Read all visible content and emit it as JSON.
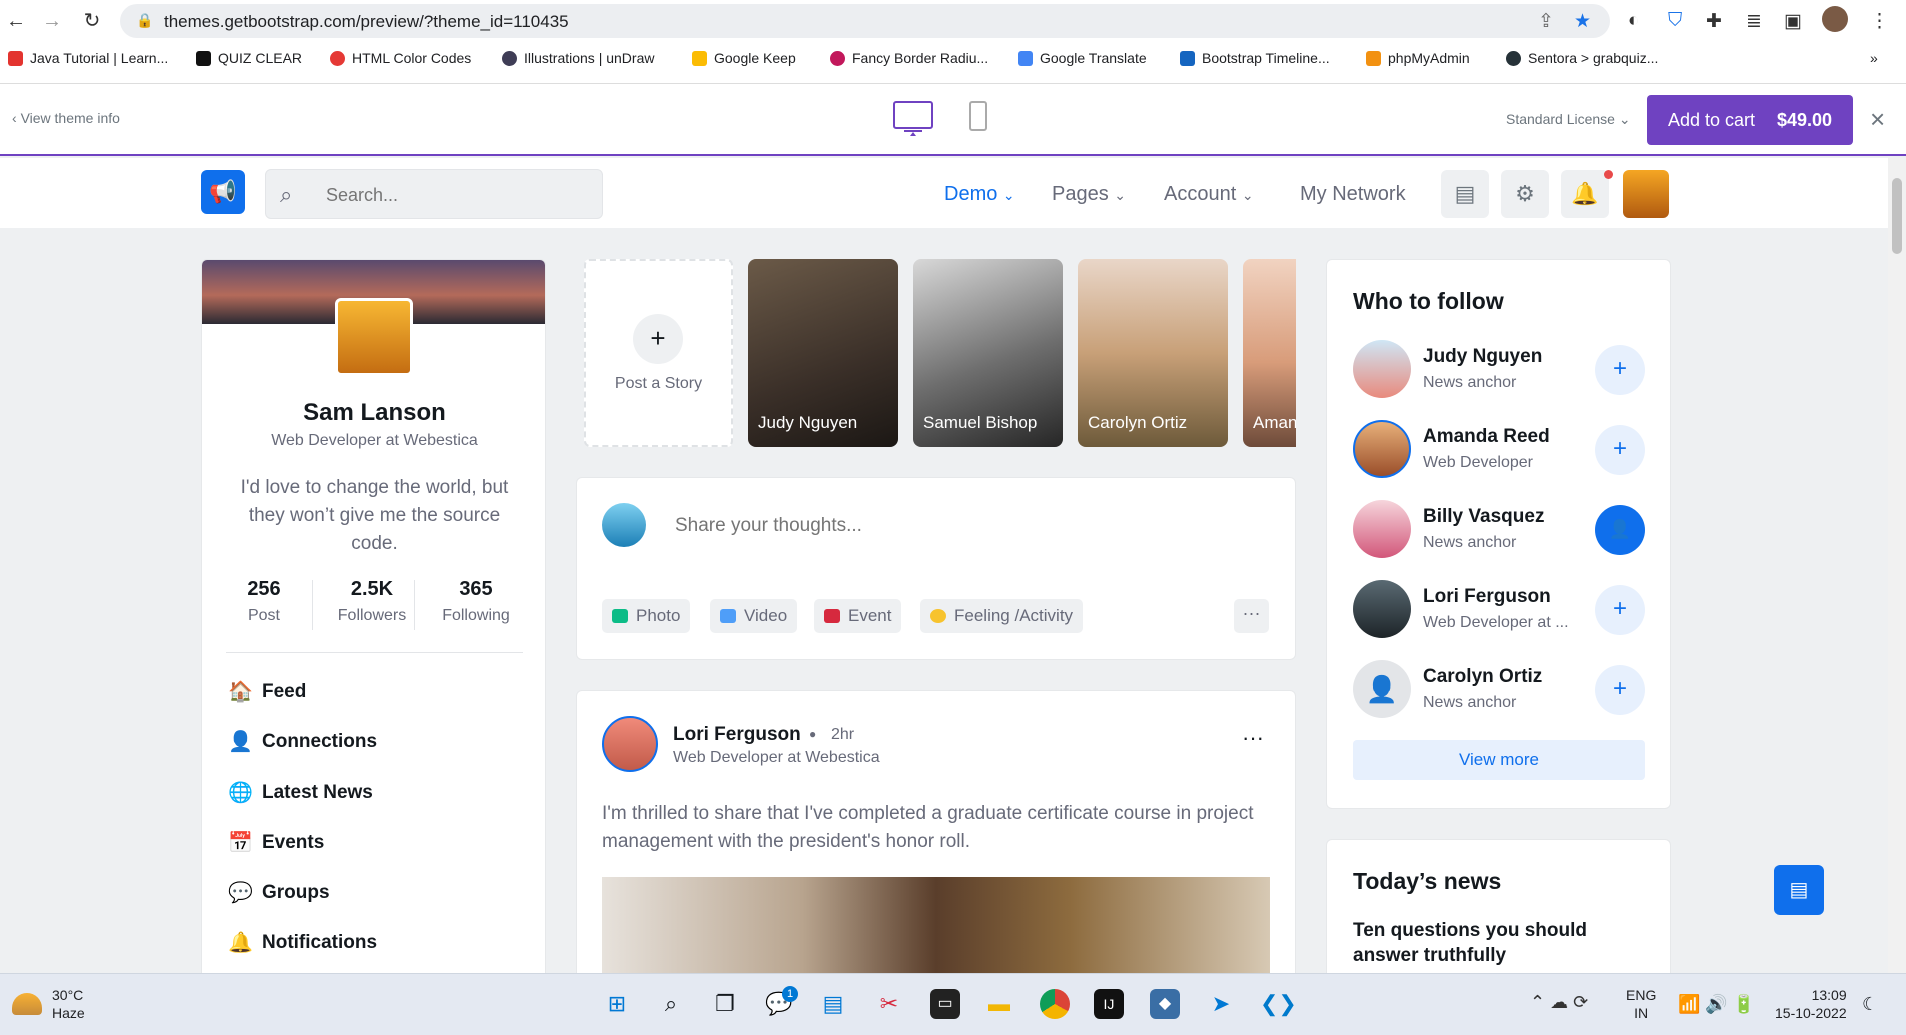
{
  "browser": {
    "url": "themes.getbootstrap.com/preview/?theme_id=110435",
    "bookmarks": [
      "Java Tutorial | Learn...",
      "QUIZ CLEAR",
      "HTML Color Codes",
      "Illustrations | unDraw",
      "Google Keep",
      "Fancy Border Radiu...",
      "Google Translate",
      "Bootstrap Timeline...",
      "phpMyAdmin",
      "Sentora > grabquiz..."
    ],
    "more": "»"
  },
  "preview_bar": {
    "back_label": "View theme info",
    "license": "Standard License",
    "cart_label": "Add to cart",
    "price": "$49.00",
    "close": "×"
  },
  "header": {
    "search_placeholder": "Search...",
    "nav": [
      "Demo",
      "Pages",
      "Account",
      "My Network"
    ]
  },
  "profile": {
    "name": "Sam Lanson",
    "role": "Web Developer at Webestica",
    "bio": "I'd love to change the world, but they won’t give me the source code.",
    "stats": [
      {
        "value": "256",
        "label": "Post"
      },
      {
        "value": "2.5K",
        "label": "Followers"
      },
      {
        "value": "365",
        "label": "Following"
      }
    ],
    "menu": [
      "Feed",
      "Connections",
      "Latest News",
      "Events",
      "Groups",
      "Notifications"
    ]
  },
  "stories": {
    "post_label": "Post a Story",
    "items": [
      "Judy Nguyen",
      "Samuel Bishop",
      "Carolyn Ortiz",
      "Aman"
    ]
  },
  "composer": {
    "placeholder": "Share your thoughts...",
    "actions": [
      "Photo",
      "Video",
      "Event",
      "Feeling /Activity"
    ],
    "more": "···"
  },
  "post": {
    "author": "Lori Ferguson",
    "time": "2hr",
    "role": "Web Developer at Webestica",
    "text": "I'm thrilled to share that I've completed a graduate certificate course in project management with the president's honor roll.",
    "more": "···"
  },
  "follow": {
    "title": "Who to follow",
    "items": [
      {
        "name": "Judy Nguyen",
        "role": "News anchor"
      },
      {
        "name": "Amanda Reed",
        "role": "Web Developer"
      },
      {
        "name": "Billy Vasquez",
        "role": "News anchor"
      },
      {
        "name": "Lori Ferguson",
        "role": "Web Developer at ..."
      },
      {
        "name": "Carolyn Ortiz",
        "role": "News anchor"
      }
    ],
    "view_more": "View more"
  },
  "news": {
    "title": "Today’s news",
    "headline": "Ten questions you should answer truthfully"
  },
  "taskbar": {
    "temp": "30°C",
    "weather": "Haze",
    "lang1": "ENG",
    "lang2": "IN",
    "time": "13:09",
    "date": "15-10-2022",
    "badge": "1"
  },
  "colors": {
    "primary": "#0f6fec",
    "purple": "#6f42c1"
  }
}
